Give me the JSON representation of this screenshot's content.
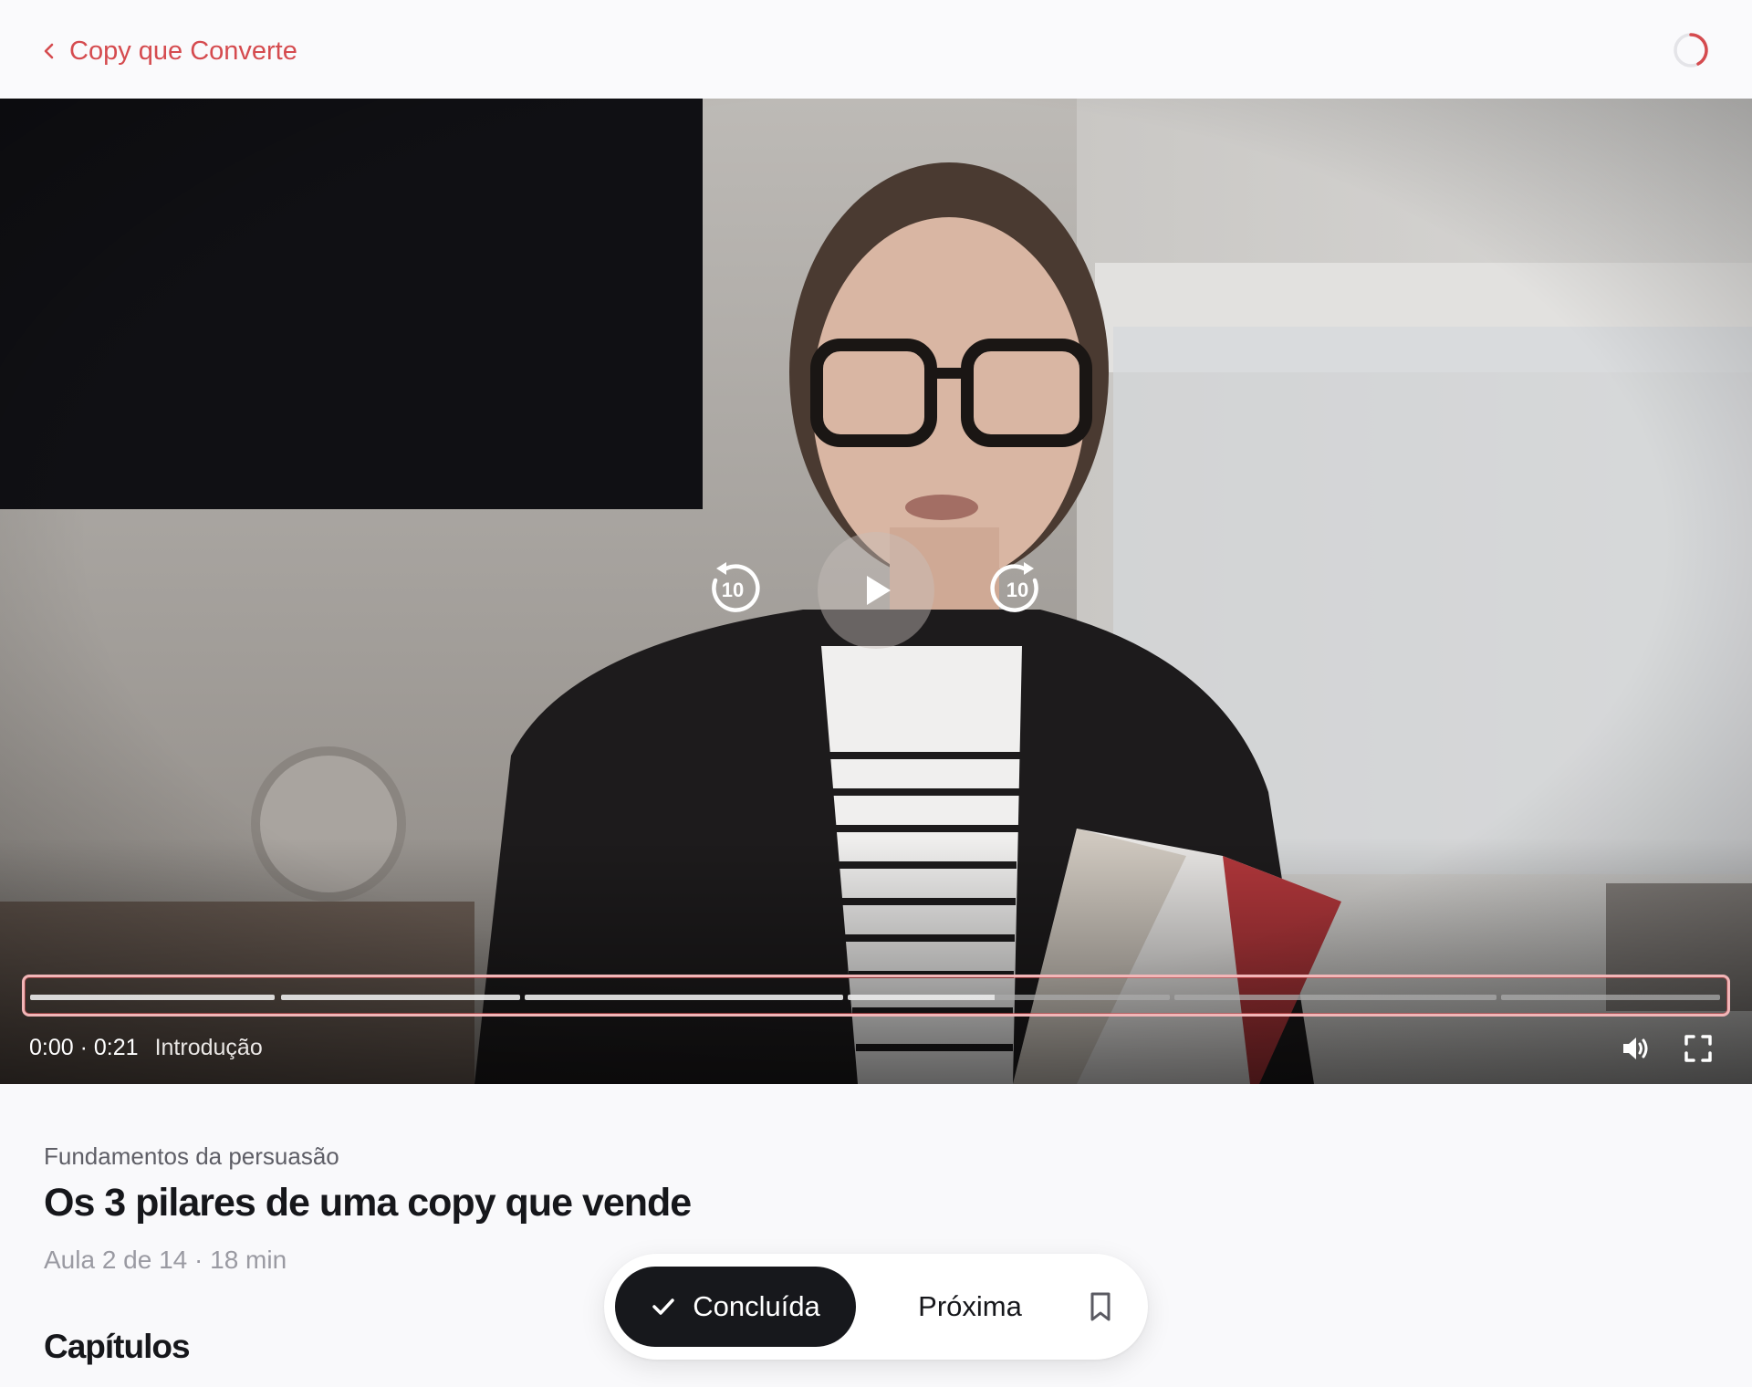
{
  "header": {
    "back_label": "Copy que Converte",
    "back_icon": "chevron-left-icon",
    "progress_icon": "progress-ring-icon",
    "accent_color": "#d54b4f"
  },
  "player": {
    "current_time": "0:00",
    "duration": "0:21",
    "separator": "·",
    "chapter_label": "Introdução",
    "skip_back_label": "10",
    "skip_forward_label": "10",
    "played_fraction": 0.0,
    "buffered_fraction": 0.57,
    "chapter_count": 7
  },
  "lesson": {
    "module": "Fundamentos da persuasão",
    "title": "Os 3 pilares de uma copy que vende",
    "meta": "Aula 2 de 14 · 18 min"
  },
  "section": {
    "chapters_heading": "Capítulos"
  },
  "actions": {
    "done_label": "Concluída",
    "next_label": "Próxima",
    "bookmark_icon": "bookmark-icon"
  }
}
